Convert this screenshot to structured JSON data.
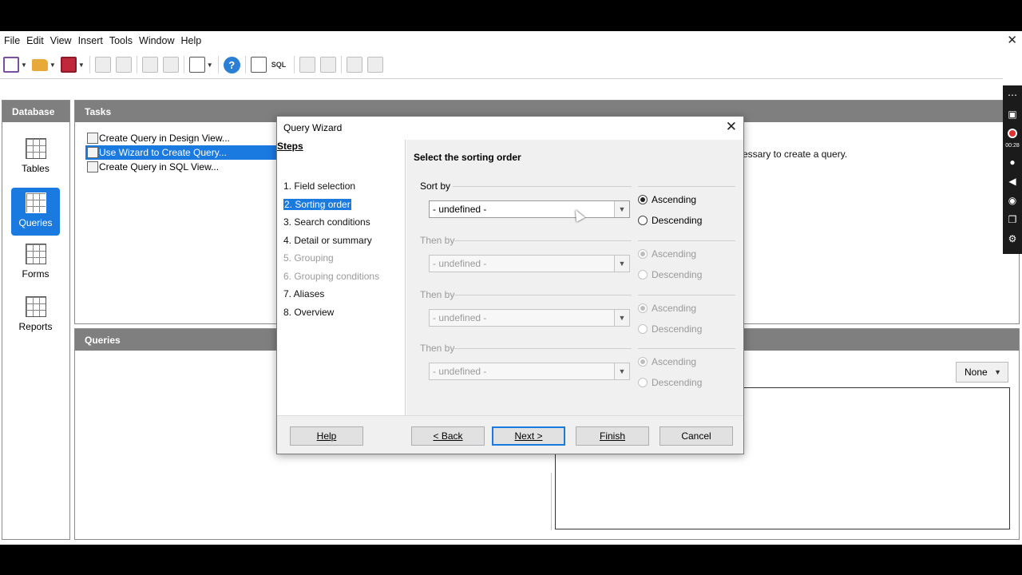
{
  "menu": [
    "File",
    "Edit",
    "View",
    "Insert",
    "Tools",
    "Window",
    "Help"
  ],
  "toolbar_icons": [
    "new-document-icon",
    "open-folder-icon",
    "save-icon",
    "copy-icon",
    "paste-icon",
    "sort-ascending-icon",
    "sort-descending-icon",
    "form-icon",
    "help-icon",
    "query-design-icon",
    "sql-icon",
    "table-icon",
    "relationships-icon",
    "delete-icon",
    "report-icon"
  ],
  "toolbar_sql": "SQL",
  "database_panel": {
    "title": "Database",
    "items": [
      {
        "label": "Tables",
        "icon": "table-icon",
        "active": false
      },
      {
        "label": "Queries",
        "icon": "query-icon",
        "active": true
      },
      {
        "label": "Forms",
        "icon": "form-icon",
        "active": false
      },
      {
        "label": "Reports",
        "icon": "report-icon",
        "active": false
      }
    ]
  },
  "tasks_panel": {
    "title": "Tasks",
    "items": [
      {
        "label": "Create Query in Design View...",
        "selected": false
      },
      {
        "label": "Use Wizard to Create Query...",
        "selected": true
      },
      {
        "label": "Create Query in SQL View...",
        "selected": false
      }
    ],
    "description": "essary to create a query."
  },
  "queries_panel": {
    "title": "Queries",
    "preview_select": "None"
  },
  "recorder": {
    "timer": "00:28"
  },
  "dialog": {
    "title": "Query Wizard",
    "steps_heading": "Steps",
    "steps": [
      {
        "label": "1. Field selection",
        "state": "normal"
      },
      {
        "label": "2. Sorting order",
        "state": "current"
      },
      {
        "label": "3. Search conditions",
        "state": "normal"
      },
      {
        "label": "4. Detail or summary",
        "state": "normal"
      },
      {
        "label": "5. Grouping",
        "state": "disabled"
      },
      {
        "label": "6. Grouping conditions",
        "state": "disabled"
      },
      {
        "label": "7. Aliases",
        "state": "normal"
      },
      {
        "label": "8. Overview",
        "state": "normal"
      }
    ],
    "heading": "Select the sorting order",
    "sort_groups": [
      {
        "label": "Sort by",
        "value": "- undefined -",
        "enabled": true,
        "ascending": "Ascending",
        "descending": "Descending",
        "selected": "Ascending"
      },
      {
        "label": "Then by",
        "value": "- undefined -",
        "enabled": false,
        "ascending": "Ascending",
        "descending": "Descending",
        "selected": "Ascending"
      },
      {
        "label": "Then by",
        "value": "- undefined -",
        "enabled": false,
        "ascending": "Ascending",
        "descending": "Descending",
        "selected": "Ascending"
      },
      {
        "label": "Then by",
        "value": "- undefined -",
        "enabled": false,
        "ascending": "Ascending",
        "descending": "Descending",
        "selected": "Ascending"
      }
    ],
    "buttons": {
      "help": "Help",
      "back": "< Back",
      "next": "Next >",
      "finish": "Finish",
      "cancel": "Cancel"
    }
  }
}
